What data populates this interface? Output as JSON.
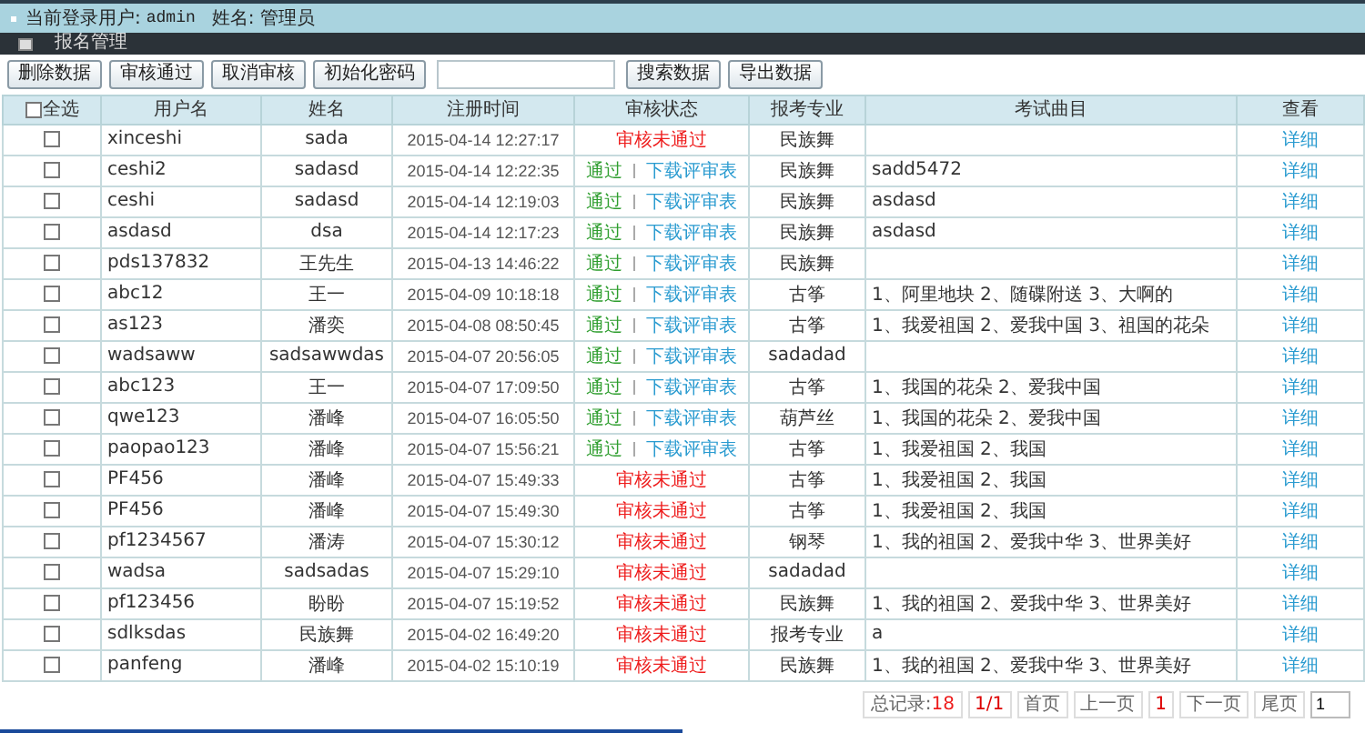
{
  "header": {
    "user_label": "当前登录用户:",
    "user": "admin",
    "name_label": "姓名:",
    "name": "管理员"
  },
  "nav": {
    "title": "报名管理"
  },
  "toolbar": {
    "buttons_left": [
      "删除数据",
      "审核通过",
      "取消审核",
      "初始化密码"
    ],
    "buttons_right": [
      "搜索数据",
      "导出数据"
    ]
  },
  "table": {
    "select_all": {
      "label": "全选",
      "checked": false
    },
    "columns": [
      "用户名",
      "姓名",
      "注册时间",
      "审核状态",
      "报考专业",
      "考试曲目",
      "查看"
    ],
    "rows": [
      {
        "checked": false,
        "username": "xinceshi",
        "name": "sada",
        "time": "2015-04-14 12:27:17",
        "status": {
          "kind": "failed",
          "text": "审核未通过"
        },
        "major": "民族舞",
        "view": "详细"
      },
      {
        "checked": false,
        "username": "ceshi2",
        "name": "sadasd",
        "time": "2015-04-14 12:22:35",
        "status": {
          "kind": "passed",
          "text": "通过",
          "link": "下载评审表"
        },
        "major": "民族舞",
        "subjects": "sadd5472",
        "view": "详细"
      },
      {
        "checked": false,
        "username": "ceshi",
        "name": "sadasd",
        "time": "2015-04-14 12:19:03",
        "status": {
          "kind": "passed",
          "text": "通过",
          "link": "下载评审表"
        },
        "major": "民族舞",
        "subjects": "asdasd",
        "view": "详细"
      },
      {
        "checked": false,
        "username": "asdasd",
        "name": "dsa",
        "time": "2015-04-14 12:17:23",
        "status": {
          "kind": "passed",
          "text": "通过",
          "link": "下载评审表"
        },
        "major": "民族舞",
        "subjects": "asdasd",
        "view": "详细"
      },
      {
        "checked": false,
        "username": "pds137832",
        "name": "王先生",
        "time": "2015-04-13 14:46:22",
        "status": {
          "kind": "passed",
          "text": "通过",
          "link": "下载评审表"
        },
        "major": "民族舞",
        "view": "详细"
      },
      {
        "checked": false,
        "username": "abc12",
        "name": "王一",
        "time": "2015-04-09 10:18:18",
        "status": {
          "kind": "passed",
          "text": "通过",
          "link": "下载评审表"
        },
        "major": "古筝",
        "subjects": "1、阿里地块 2、随碟附送 3、大啊的",
        "view": "详细"
      },
      {
        "checked": false,
        "username": "as123",
        "name": "潘奕",
        "time": "2015-04-08 08:50:45",
        "status": {
          "kind": "passed",
          "text": "通过",
          "link": "下载评审表"
        },
        "major": "古筝",
        "subjects": "1、我爱祖国 2、爱我中国 3、祖国的花朵",
        "view": "详细"
      },
      {
        "checked": false,
        "username": "wadsaww",
        "name": "sadsawwdas",
        "time": "2015-04-07 20:56:05",
        "status": {
          "kind": "passed",
          "text": "通过",
          "link": "下载评审表"
        },
        "major": "sadadad",
        "view": "详细"
      },
      {
        "checked": false,
        "username": "abc123",
        "name": "王一",
        "time": "2015-04-07 17:09:50",
        "status": {
          "kind": "passed",
          "text": "通过",
          "link": "下载评审表"
        },
        "major": "古筝",
        "subjects": "1、我国的花朵 2、爱我中国",
        "view": "详细"
      },
      {
        "checked": false,
        "username": "qwe123",
        "name": "潘峰",
        "time": "2015-04-07 16:05:50",
        "status": {
          "kind": "passed",
          "text": "通过",
          "link": "下载评审表"
        },
        "major": "葫芦丝",
        "subjects": "1、我国的花朵 2、爱我中国",
        "view": "详细"
      },
      {
        "checked": false,
        "username": "paopao123",
        "name": "潘峰",
        "time": "2015-04-07 15:56:21",
        "status": {
          "kind": "passed",
          "text": "通过",
          "link": "下载评审表"
        },
        "major": "古筝",
        "subjects": "1、我爱祖国 2、我国",
        "view": "详细"
      },
      {
        "checked": false,
        "username": "PF456",
        "name": "潘峰",
        "time": "2015-04-07 15:49:33",
        "status": {
          "kind": "failed",
          "text": "审核未通过"
        },
        "major": "古筝",
        "subjects": "1、我爱祖国 2、我国",
        "view": "详细"
      },
      {
        "checked": false,
        "username": "PF456",
        "name": "潘峰",
        "time": "2015-04-07 15:49:30",
        "status": {
          "kind": "failed",
          "text": "审核未通过"
        },
        "major": "古筝",
        "subjects": "1、我爱祖国 2、我国",
        "view": "详细"
      },
      {
        "checked": false,
        "username": "pf1234567",
        "name": "潘涛",
        "time": "2015-04-07 15:30:12",
        "status": {
          "kind": "failed",
          "text": "审核未通过"
        },
        "major": "钢琴",
        "subjects": "1、我的祖国 2、爱我中华 3、世界美好",
        "view": "详细"
      },
      {
        "checked": false,
        "username": "wadsa",
        "name": "sadsadas",
        "time": "2015-04-07 15:29:10",
        "status": {
          "kind": "failed",
          "text": "审核未通过"
        },
        "major": "sadadad",
        "view": "详细"
      },
      {
        "checked": false,
        "username": "pf123456",
        "name": "盼盼",
        "time": "2015-04-07 15:19:52",
        "status": {
          "kind": "failed",
          "text": "审核未通过"
        },
        "major": "民族舞",
        "subjects": "1、我的祖国 2、爱我中华 3、世界美好",
        "view": "详细"
      },
      {
        "checked": false,
        "username": "sdlksdas",
        "name": "民族舞",
        "time": "2015-04-02 16:49:20",
        "status": {
          "kind": "failed",
          "text": "审核未通过"
        },
        "major": "报考专业",
        "subjects": "a",
        "view": "详细"
      },
      {
        "checked": false,
        "username": "panfeng",
        "name": "潘峰",
        "time": "2015-04-02 15:10:19",
        "status": {
          "kind": "failed",
          "text": "审核未通过"
        },
        "major": "民族舞",
        "subjects": "1、我的祖国 2、爱我中华 3、世界美好",
        "view": "详细"
      }
    ]
  },
  "pagination": {
    "total_label": "总记录:",
    "total": "18",
    "pages": "1/1",
    "first": "首页",
    "prev": "上一页",
    "current": "1",
    "next": "下一页",
    "last": "尾页",
    "page_input": "1"
  }
}
